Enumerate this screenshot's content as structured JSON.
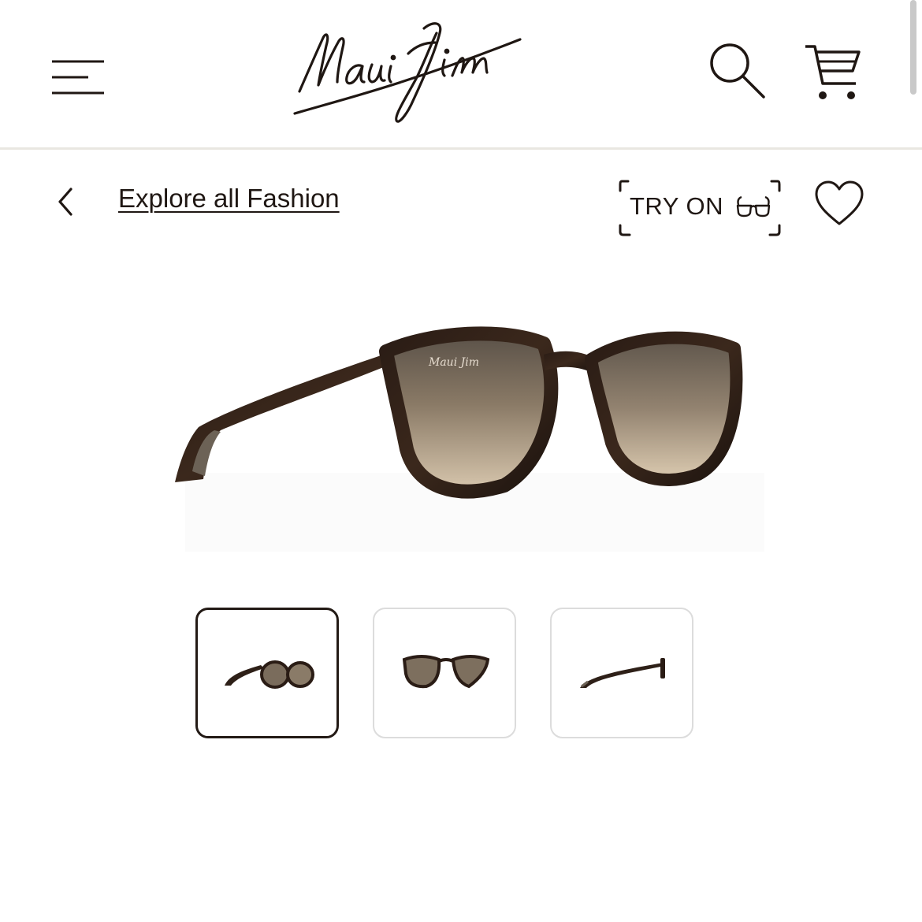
{
  "header": {
    "logo_text": "Maui Jim",
    "menu_icon": "hamburger-menu-icon",
    "search_icon": "search-icon",
    "cart_icon": "cart-icon"
  },
  "nav": {
    "back_icon": "chevron-left-icon",
    "explore_label": "Explore all Fashion",
    "try_on_label": "TRY ON",
    "try_on_icon": "glasses-icon",
    "wishlist_icon": "heart-icon"
  },
  "product": {
    "image_alt": "Tortoise sunglasses with bronze gradient lenses",
    "thumbnails": [
      {
        "view": "angled",
        "selected": true
      },
      {
        "view": "front",
        "selected": false
      },
      {
        "view": "side",
        "selected": false
      }
    ]
  },
  "colors": {
    "text": "#221a15",
    "divider": "#e9e7e1",
    "thumb_border_active": "#231a15",
    "thumb_border_inactive": "#dcdcdc"
  }
}
